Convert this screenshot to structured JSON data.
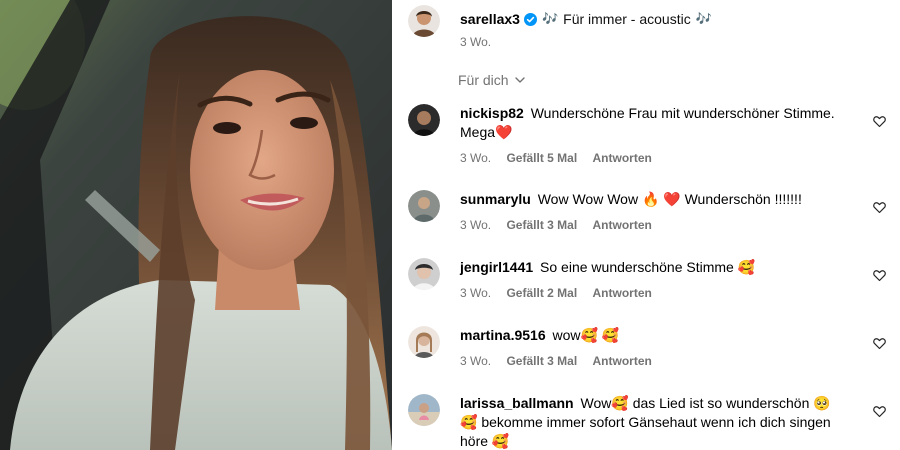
{
  "post": {
    "username": "sarellax3",
    "verified": true,
    "music_note": "🎶",
    "song": "Für immer - acoustic",
    "time": "3 Wo."
  },
  "filter": {
    "label": "Für dich",
    "icon": "chevron-down-icon"
  },
  "comments": [
    {
      "username": "nickisp82",
      "text": "Wunderschöne Frau mit wunderschöner Stimme. Mega❤️",
      "time": "3 Wo.",
      "likes": "Gefällt 5 Mal",
      "reply": "Antworten",
      "avatar_color": "#2b2b2b"
    },
    {
      "username": "sunmarylu",
      "text": "Wow Wow Wow 🔥 ❤️ Wunderschön !!!!!!!",
      "time": "3 Wo.",
      "likes": "Gefällt 3 Mal",
      "reply": "Antworten",
      "avatar_color": "#8a8f8b"
    },
    {
      "username": "jengirl1441",
      "text": "So eine wunderschöne Stimme 🥰",
      "time": "3 Wo.",
      "likes": "Gefällt 2 Mal",
      "reply": "Antworten",
      "avatar_color": "#b8b8b8"
    },
    {
      "username": "martina.9516",
      "text": "wow🥰 🥰",
      "time": "3 Wo.",
      "likes": "Gefällt 3 Mal",
      "reply": "Antworten",
      "avatar_color": "#d9c8b8"
    },
    {
      "username": "larissa_ballmann",
      "text": "Wow🥰 das Lied ist so wunderschön 🥺 🥰 bekomme immer sofort Gänsehaut wenn ich dich singen höre 🥰",
      "time": "",
      "likes": "",
      "reply": "",
      "avatar_color": "#9fb7c9"
    }
  ],
  "icons": {
    "like": "heart-outline-icon",
    "verified": "verified-badge-icon"
  },
  "colors": {
    "secondary_text": "#737373",
    "verified_blue": "#0095f6",
    "heart_red": "#e0245e"
  }
}
